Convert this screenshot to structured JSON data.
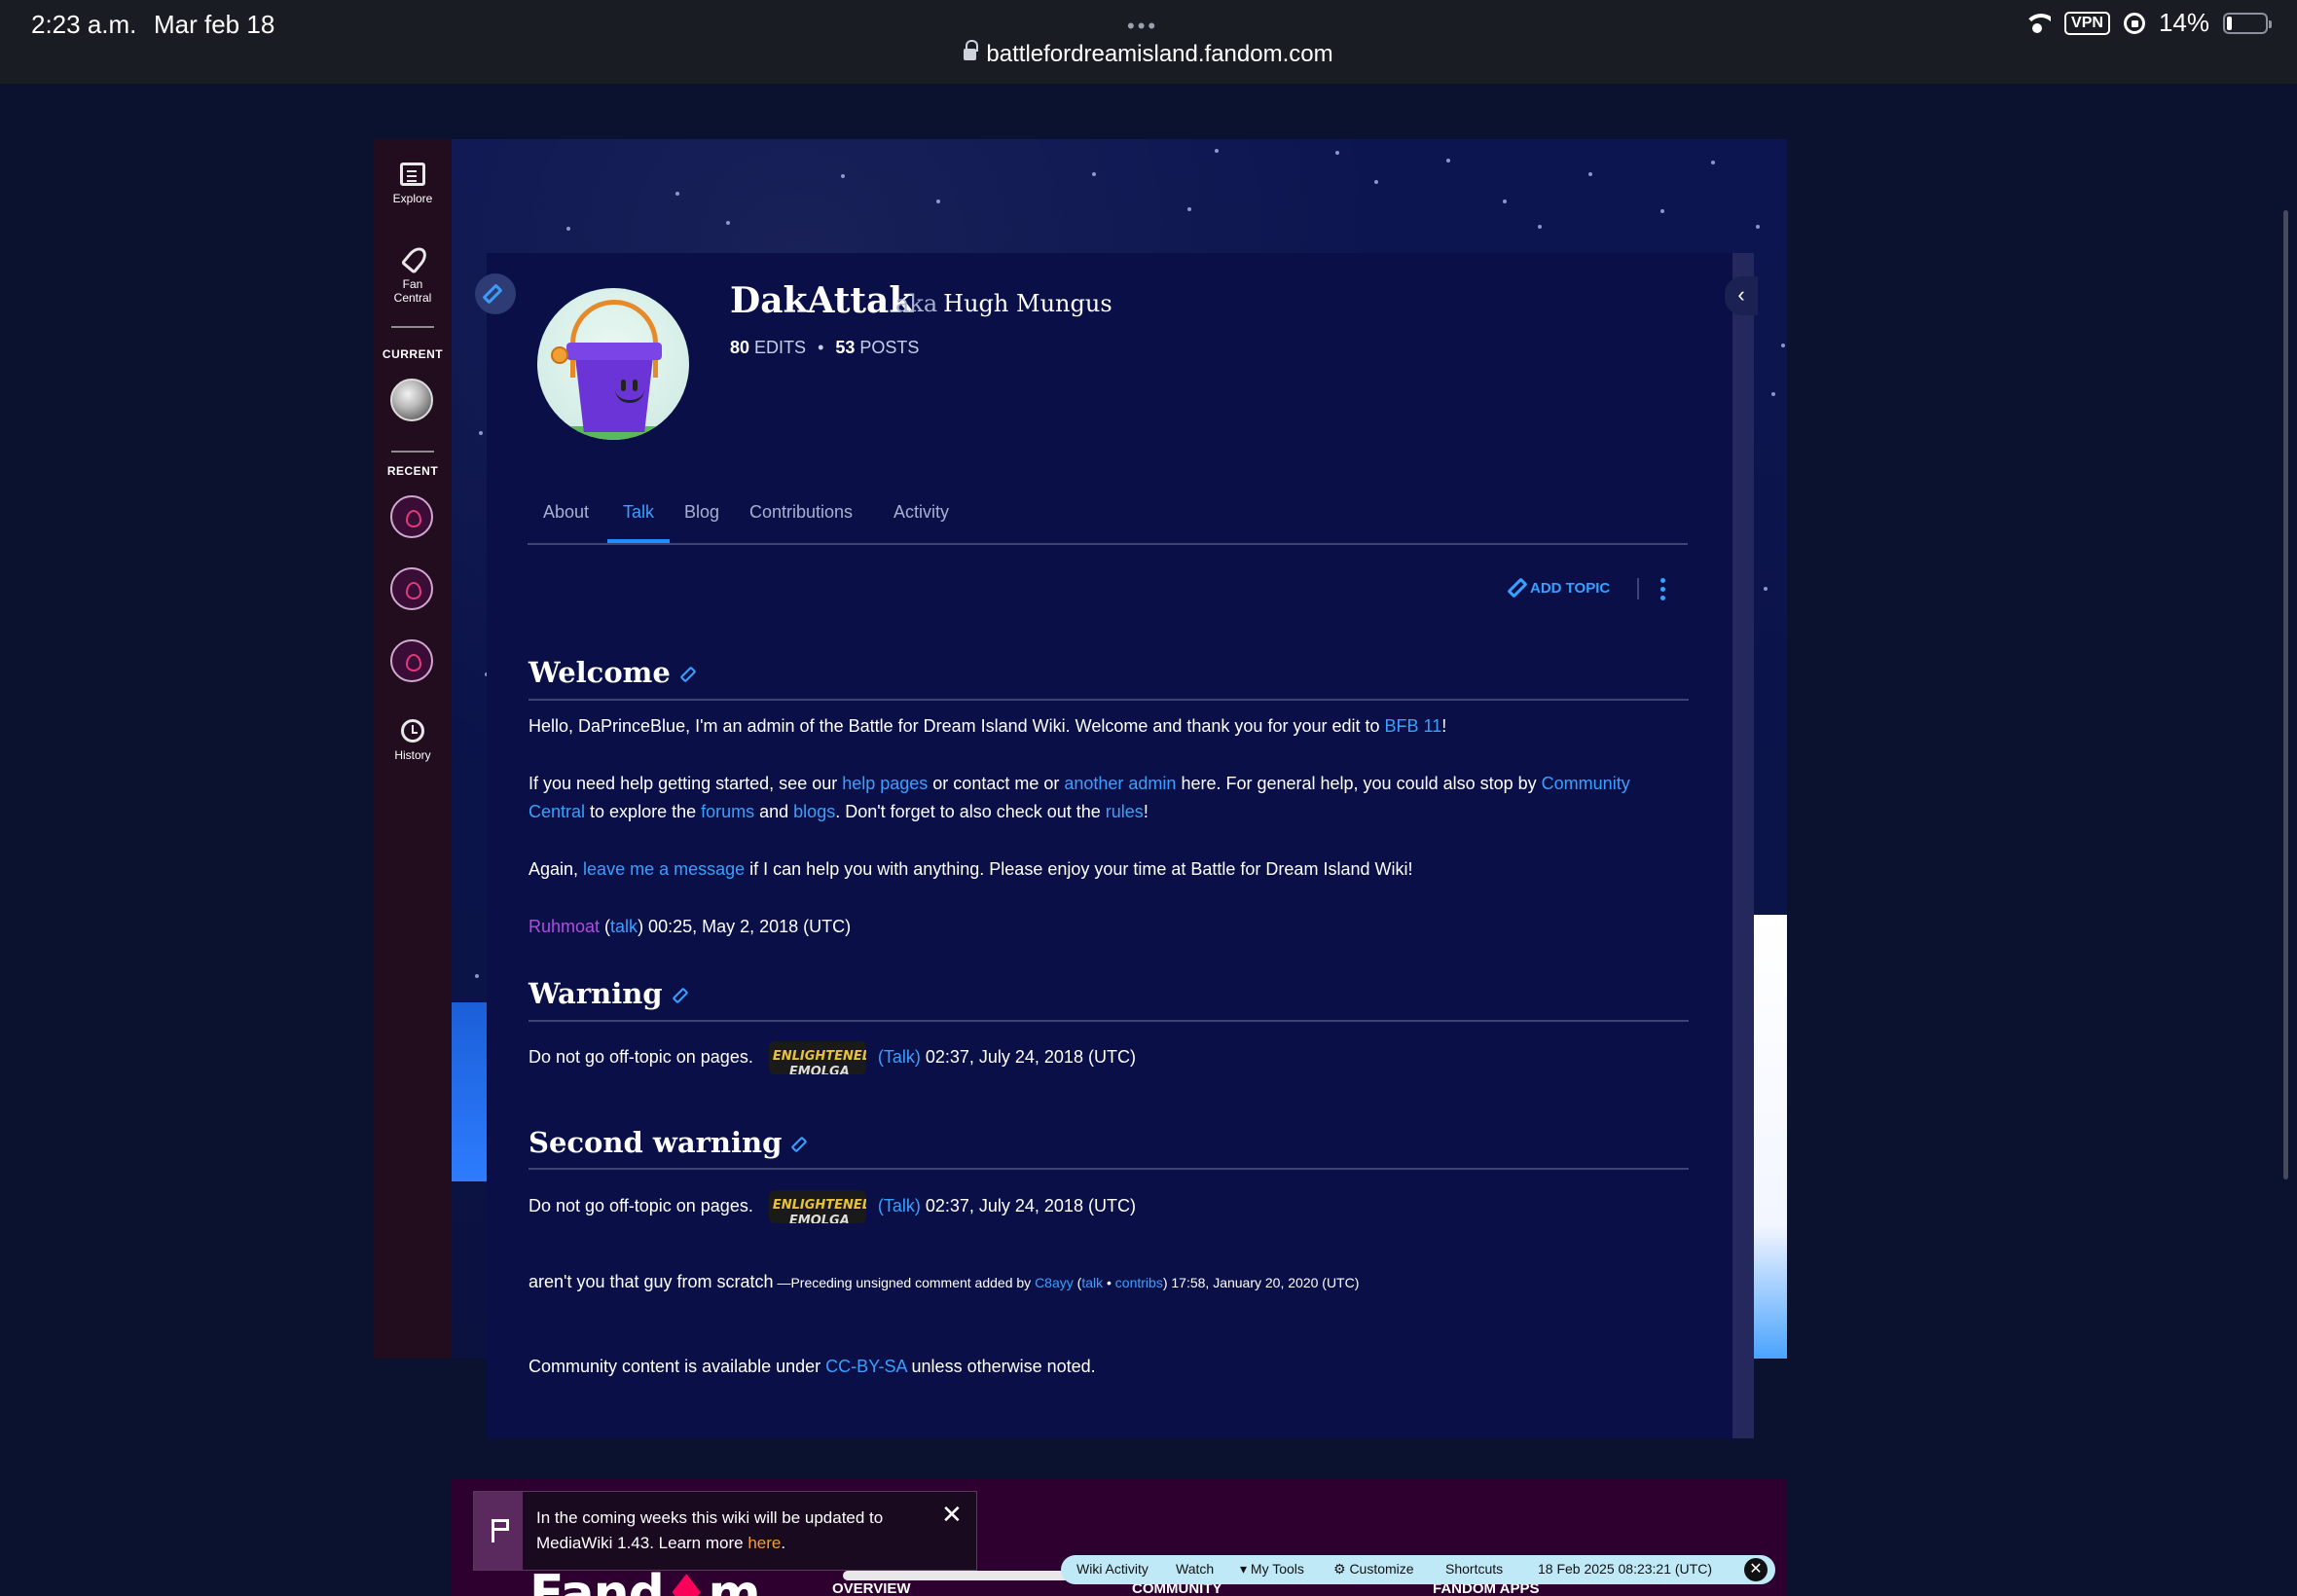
{
  "status_bar": {
    "time": "2:23 a.m.",
    "date": "Mar feb 18",
    "vpn": "VPN",
    "battery": "14%",
    "battery_level": 0.14
  },
  "browser": {
    "url": "battlefordreamisland.fandom.com",
    "dots": "•••"
  },
  "sidebar": {
    "explore": "Explore",
    "fan_central": "Fan Central",
    "current": "CURRENT",
    "recent": "RECENT",
    "history": "History"
  },
  "profile": {
    "username": "DakAttak",
    "aka_label": "aka",
    "nickname": "Hugh Mungus",
    "edits_count": "80",
    "edits_label": "EDITS",
    "posts_count": "53",
    "posts_label": "POSTS",
    "dot": "•"
  },
  "tabs": [
    "About",
    "Talk",
    "Blog",
    "Contributions",
    "Activity"
  ],
  "actions": {
    "add_topic": "ADD TOPIC"
  },
  "sections": {
    "welcome": {
      "title": "Welcome",
      "p1_a": "Hello, DaPrinceBlue, I'm an admin of the Battle for Dream Island Wiki. Welcome and thank you for your edit to ",
      "p1_link": "BFB 11",
      "p1_b": "!",
      "p2_a": "If you need help getting started, see our ",
      "p2_link1": "help pages",
      "p2_b": " or contact me or ",
      "p2_link2": "another admin",
      "p2_c": " here. For general help, you could also stop by ",
      "p2_link3": "Community Central",
      "p2_d": " to explore the ",
      "p2_link4": "forums",
      "p2_e": " and ",
      "p2_link5": "blogs",
      "p2_f": ". Don't forget to also check out the ",
      "p2_link6": "rules",
      "p2_g": "!",
      "p3_a": "Again, ",
      "p3_link": "leave me a message",
      "p3_b": " if I can help you with anything. Please enjoy your time at Battle for Dream Island Wiki!",
      "sig_user": "Ruhmoat",
      "sig_open": " (",
      "sig_talk": "talk",
      "sig_close": ") 00:25, May 2, 2018 (UTC)"
    },
    "warning": {
      "title": "Warning",
      "text": "Do not go off-topic on pages.",
      "badge_line1": "ENLIGHTENED",
      "badge_line2": "EMOLGA",
      "talk": "(Talk)",
      "timestamp": " 02:37, July 24, 2018 (UTC)"
    },
    "second_warning": {
      "title": "Second warning",
      "text": "Do not go off-topic on pages.",
      "badge_line1": "ENLIGHTENED",
      "badge_line2": "EMOLGA",
      "talk": "(Talk)",
      "timestamp": " 02:37, July 24, 2018 (UTC)",
      "comment": "aren't you that guy from scratch",
      "unsigned_a": " —Preceding unsigned comment added by ",
      "unsigned_user": "C8ayy",
      "unsigned_open": " (",
      "unsigned_talk": "talk",
      "unsigned_sep": " • ",
      "unsigned_contribs": "contribs",
      "unsigned_close": ") 17:58, January 20, 2020 (UTC)"
    }
  },
  "footer": {
    "text_a": "Community content is available under ",
    "license": "CC-BY-SA",
    "text_b": " unless otherwise noted."
  },
  "notice": {
    "text": "In the coming weeks this wiki will be updated to MediaWiki 1.43. Learn more ",
    "link": "here",
    "end": ".",
    "close": "✕"
  },
  "bottom": {
    "logo_a": "Fand",
    "logo_flame": "♦",
    "logo_b": "m",
    "overview": "OVERVIEW",
    "community": "COMMUNITY",
    "fandom_apps": "FANDOM APPS"
  },
  "toolbar": {
    "wiki_activity": "Wiki Activity",
    "watch": "Watch",
    "my_tools": "▾ My Tools",
    "customize": "⚙ Customize",
    "shortcuts": "Shortcuts",
    "timestamp": "18 Feb 2025 08:23:21 (UTC)",
    "close": "✕"
  }
}
